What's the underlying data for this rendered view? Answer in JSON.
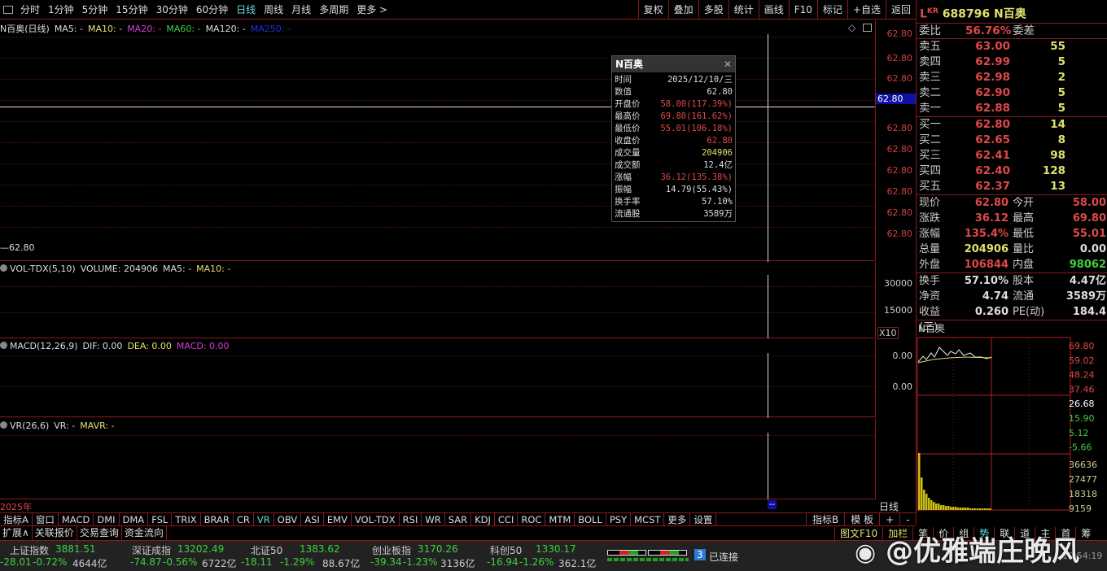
{
  "toolbar": {
    "periods": [
      "分时",
      "1分钟",
      "5分钟",
      "15分钟",
      "30分钟",
      "60分钟",
      "日线",
      "周线",
      "月线",
      "多周期",
      "更多 >"
    ],
    "active": "日线",
    "buttons": [
      "复权",
      "叠加",
      "多股",
      "统计",
      "画线",
      "F10",
      "标记",
      "+自选",
      "返回"
    ]
  },
  "main": {
    "title": "N百奥(日线)",
    "ma": [
      {
        "t": "MA5: -",
        "c": "#dddddd"
      },
      {
        "t": "MA10: -",
        "c": "#e0e070"
      },
      {
        "t": "MA20: -",
        "c": "#d040d0"
      },
      {
        "t": "MA60: -",
        "c": "#40d040"
      },
      {
        "t": "MA120: -",
        "c": "#dddddd"
      },
      {
        "t": "MA250: -",
        "c": "#2030e0"
      }
    ],
    "price_ticks": [
      "62.80",
      "62.80",
      "62.80",
      "62.80",
      "62.80",
      "62.80",
      "62.80",
      "62.80",
      "62.80",
      "62.80"
    ],
    "crosshair_price": "62.80",
    "low_label": "62.80"
  },
  "volume": {
    "legend": [
      "VOL-TDX(5,10)",
      "VOLUME: 204906",
      "MA5: -",
      "MA10: -"
    ],
    "ticks": [
      "30000",
      "15000"
    ],
    "unit": "X10"
  },
  "macd": {
    "legend": [
      "MACD(12,26,9)",
      "DIF: 0.00",
      "DEA: 0.00",
      "MACD: 0.00"
    ],
    "ticks": [
      "0.00",
      "0.00"
    ]
  },
  "vr": {
    "legend": [
      "VR(26,6)",
      "VR: -",
      "MAVR: -"
    ]
  },
  "date_axis": {
    "label": "2025年",
    "cursor": "--",
    "period": "日线"
  },
  "tooltip": {
    "title": "N百奥",
    "rows": [
      {
        "k": "时间",
        "v": "2025/12/10/三",
        "c": "#dddddd"
      },
      {
        "k": "数值",
        "v": "62.80",
        "c": "#dddddd"
      },
      {
        "k": "开盘价",
        "v": "58.00(117.39%)",
        "c": "#e04848"
      },
      {
        "k": "最高价",
        "v": "69.80(161.62%)",
        "c": "#e04848"
      },
      {
        "k": "最低价",
        "v": "55.01(106.18%)",
        "c": "#e04848"
      },
      {
        "k": "收盘价",
        "v": "62.80",
        "c": "#e04848"
      },
      {
        "k": "成交量",
        "v": "204906",
        "c": "#e0e070"
      },
      {
        "k": "成交额",
        "v": "12.4亿",
        "c": "#dddddd"
      },
      {
        "k": "涨幅",
        "v": "36.12(135.38%)",
        "c": "#e04848"
      },
      {
        "k": "振幅",
        "v": "14.79(55.43%)",
        "c": "#dddddd"
      },
      {
        "k": "换手率",
        "v": "57.10%",
        "c": "#dddddd"
      },
      {
        "k": "流通股",
        "v": "3589万",
        "c": "#dddddd"
      }
    ]
  },
  "quote": {
    "badge": "L",
    "badge_sup": "KR",
    "code": "688796",
    "name": "N百奥",
    "weibi_label": "委比",
    "weibi": "56.76%",
    "weicha_label": "委差",
    "asks": [
      {
        "l": "卖五",
        "p": "63.00",
        "v": "55"
      },
      {
        "l": "卖四",
        "p": "62.99",
        "v": "5"
      },
      {
        "l": "卖三",
        "p": "62.98",
        "v": "2"
      },
      {
        "l": "卖二",
        "p": "62.90",
        "v": "5"
      },
      {
        "l": "卖一",
        "p": "62.88",
        "v": "5"
      }
    ],
    "bids": [
      {
        "l": "买一",
        "p": "62.80",
        "v": "14"
      },
      {
        "l": "买二",
        "p": "62.65",
        "v": "8"
      },
      {
        "l": "买三",
        "p": "62.41",
        "v": "98"
      },
      {
        "l": "买四",
        "p": "62.40",
        "v": "128"
      },
      {
        "l": "买五",
        "p": "62.37",
        "v": "13"
      }
    ],
    "stats1": [
      [
        "现价",
        "62.80",
        "#e04848",
        "今开",
        "58.00",
        "#e04848"
      ],
      [
        "涨跌",
        "36.12",
        "#e04848",
        "最高",
        "69.80",
        "#e04848"
      ],
      [
        "涨幅",
        "135.4%",
        "#e04848",
        "最低",
        "55.01",
        "#e04848"
      ],
      [
        "总量",
        "204906",
        "#e0e070",
        "量比",
        "0.00",
        "#dddddd"
      ],
      [
        "外盘",
        "106844",
        "#e04848",
        "内盘",
        "98062",
        "#40d040"
      ]
    ],
    "stats2": [
      [
        "换手",
        "57.10%",
        "#dddddd",
        "股本",
        "4.47亿",
        "#dddddd"
      ],
      [
        "净资",
        "4.74",
        "#dddddd",
        "流通",
        "3589万",
        "#dddddd"
      ],
      [
        "收益(三)",
        "0.260",
        "#dddddd",
        "PE(动)",
        "184.4",
        "#dddddd"
      ]
    ]
  },
  "mini": {
    "name": "N百奥",
    "price_ticks": [
      {
        "t": "69.80",
        "c": "#e04848"
      },
      {
        "t": "59.02",
        "c": "#e04848"
      },
      {
        "t": "48.24",
        "c": "#e04848"
      },
      {
        "t": "37.46",
        "c": "#e04848"
      },
      {
        "t": "26.68",
        "c": "#ffffff"
      },
      {
        "t": "15.90",
        "c": "#40d040"
      },
      {
        "t": "5.12",
        "c": "#40d040"
      },
      {
        "t": "-5.66",
        "c": "#40d040"
      }
    ],
    "vol_ticks": [
      "36636",
      "27477",
      "18318",
      "9159"
    ]
  },
  "indicator_tabs": [
    "指标A",
    "窗口",
    "MACD",
    "DMI",
    "DMA",
    "FSL",
    "TRIX",
    "BRAR",
    "CR",
    "VR",
    "OBV",
    "ASI",
    "EMV",
    "VOL-TDX",
    "RSI",
    "WR",
    "SAR",
    "KDJ",
    "CCI",
    "ROC",
    "MTM",
    "BOLL",
    "PSY",
    "MCST",
    "更多",
    "设置"
  ],
  "indicator_active": "VR",
  "indicator_right": [
    "指标B",
    "模 板",
    "+",
    "-"
  ],
  "ext_tabs": [
    "扩展∧",
    "关联报价",
    "交易查询",
    "资金流向"
  ],
  "ext_right": [
    "图文F10",
    "加栏",
    "笔",
    "价",
    "组",
    "势",
    "联",
    "道",
    "主",
    "首",
    "筹"
  ],
  "indices": [
    {
      "name": "上证指数",
      "val": "3881.51",
      "chg": "-28.01",
      "pct": "-0.72%",
      "amt": "4644亿"
    },
    {
      "name": "深证成指",
      "val": "13202.49",
      "chg": "-74.87",
      "pct": "-0.56%",
      "amt": "6722亿"
    },
    {
      "name": "北证50",
      "val": "1383.62",
      "chg": "-18.11",
      "pct": "-1.29%",
      "amt": "88.67亿"
    },
    {
      "name": "创业板指",
      "val": "3170.26",
      "chg": "-39.34",
      "pct": "-1.23%",
      "amt": "3136亿"
    },
    {
      "name": "科创50",
      "val": "1330.17",
      "chg": "-16.94",
      "pct": "-1.26%",
      "amt": "362.1亿"
    }
  ],
  "connection": {
    "count": "3",
    "label": "已连接"
  },
  "clock": "10:54:19",
  "watermark": "@优雅端庄晚风"
}
